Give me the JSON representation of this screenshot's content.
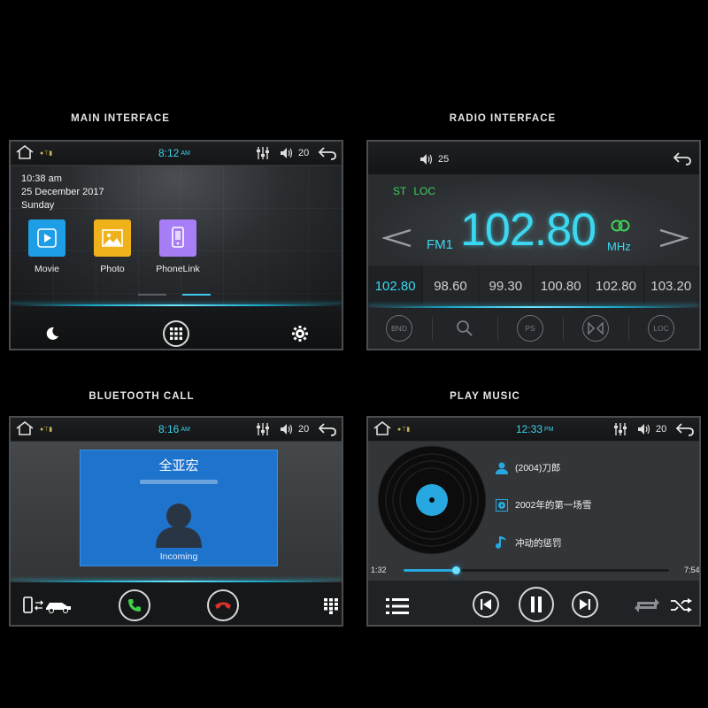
{
  "captions": {
    "main": "MAIN INTERFACE",
    "radio": "RADIO INTERFACE",
    "bluetooth": "BLUETOOTH CALL",
    "music": "PLAY MUSIC"
  },
  "main": {
    "time": "8:12",
    "ampm": "AM",
    "volume": "20",
    "clock_time": "10:38 am",
    "date": "25 December 2017",
    "weekday": "Sunday",
    "apps": [
      {
        "label": "Movie",
        "color": "#1f9ee8"
      },
      {
        "label": "Photo",
        "color": "#f0b21a"
      },
      {
        "label": "PhoneLink",
        "color": "#a77ef6"
      }
    ],
    "page_indicator": {
      "count": 2,
      "active": 2
    }
  },
  "radio": {
    "volume": "25",
    "st_label": "ST",
    "loc_label": "LOC",
    "band": "FM1",
    "frequency": "102.80",
    "unit": "MHz",
    "presets": [
      "102.80",
      "98.60",
      "99.30",
      "100.80",
      "102.80",
      "103.20"
    ],
    "active_preset": 0,
    "buttons": [
      "BND",
      "search-icon",
      "PS",
      "stereo-icon",
      "LOC"
    ]
  },
  "bluetooth": {
    "time": "8:16",
    "ampm": "AM",
    "volume": "20",
    "caller_name": "全亚宏",
    "status": "Incoming",
    "card_color": "#1e73cc"
  },
  "music": {
    "time": "12:33",
    "ampm": "PM",
    "volume": "20",
    "artist": "(2004)刀郎",
    "album": "2002年的第一场雪",
    "title": "冲动的惩罚",
    "elapsed": "1:32",
    "total": "7:54",
    "progress": 0.195,
    "accent": "#27a8e0"
  }
}
